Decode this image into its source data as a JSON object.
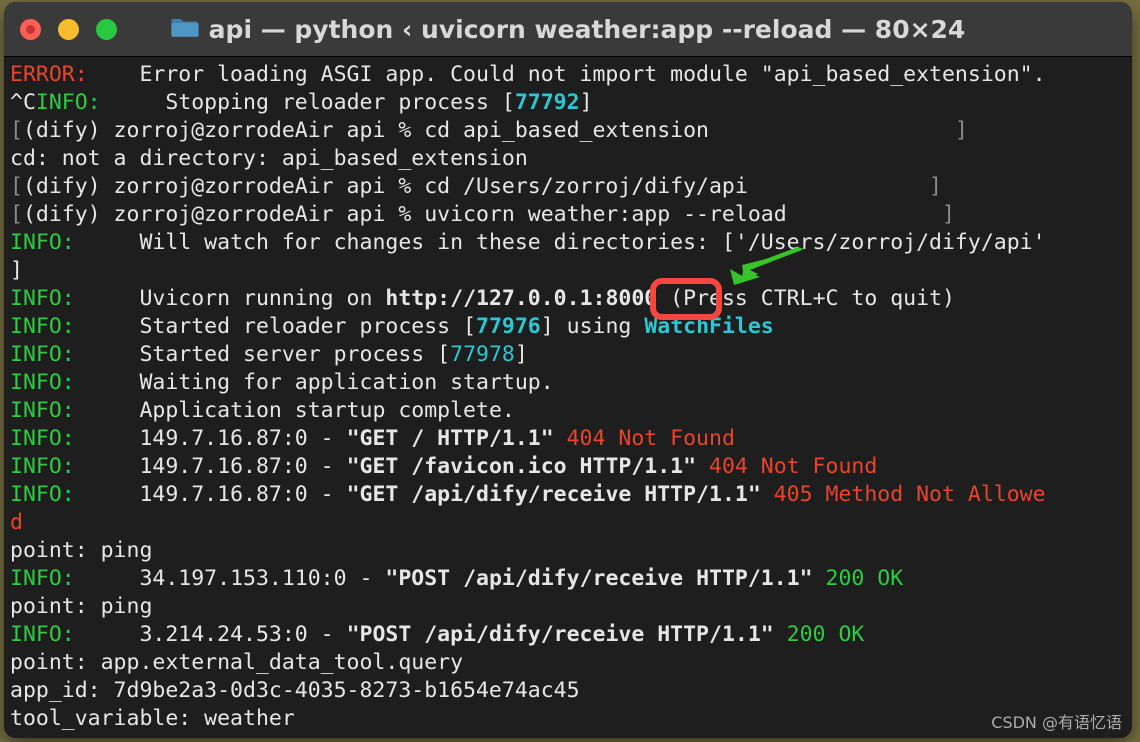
{
  "window": {
    "title": "api — python ‹ uvicorn weather:app --reload — 80×24",
    "folder_icon": "folder-icon",
    "controls": {
      "close": "close-button",
      "minimize": "minimize-button",
      "zoom": "zoom-button"
    }
  },
  "annotations": {
    "highlight_label": "8000",
    "highlight_color": "#f4473f",
    "arrow_color": "#38c32b"
  },
  "watermark": "CSDN @有语忆语",
  "colors": {
    "background": "#1e1e1e",
    "foreground": "#e6e6e6",
    "red": "#e8452c",
    "green": "#2ecc40",
    "cyan": "#2bc7d4",
    "gray": "#8a8a8a",
    "titlebar": "#3a3a3a"
  },
  "terminal": {
    "rows": 24,
    "cols": 80,
    "lines": [
      {
        "id": "line-1",
        "segs": [
          {
            "t": "ERROR:",
            "c": "c-red"
          },
          {
            "t": "    Error loading ASGI app. Could not import module \"api_based_extension\".",
            "c": "c-white"
          }
        ]
      },
      {
        "id": "line-2",
        "segs": [
          {
            "t": "^C",
            "c": "c-white"
          },
          {
            "t": "INFO:",
            "c": "c-green"
          },
          {
            "t": "     Stopping reloader process [",
            "c": "c-white"
          },
          {
            "t": "77792",
            "c": "c-cyan b"
          },
          {
            "t": "]",
            "c": "c-white"
          }
        ]
      },
      {
        "id": "line-3",
        "segs": [
          {
            "t": "[",
            "c": "c-gray"
          },
          {
            "t": "(dify) zorroj@zorrodeAir api % cd api_based_extension",
            "c": "c-white"
          },
          {
            "t": "                   ]",
            "c": "c-gray"
          }
        ]
      },
      {
        "id": "line-4",
        "segs": [
          {
            "t": "cd: not a directory: api_based_extension",
            "c": "c-white"
          }
        ]
      },
      {
        "id": "line-5",
        "segs": [
          {
            "t": "[",
            "c": "c-gray"
          },
          {
            "t": "(dify) zorroj@zorrodeAir api % cd /Users/zorroj/dify/api",
            "c": "c-white"
          },
          {
            "t": "              ]",
            "c": "c-gray"
          }
        ]
      },
      {
        "id": "line-6",
        "segs": [
          {
            "t": "[",
            "c": "c-gray"
          },
          {
            "t": "(dify) zorroj@zorrodeAir api % uvicorn weather:app --reload",
            "c": "c-white"
          },
          {
            "t": "            ]",
            "c": "c-gray"
          }
        ]
      },
      {
        "id": "line-7",
        "segs": [
          {
            "t": "INFO:",
            "c": "c-green"
          },
          {
            "t": "     Will watch for changes in these directories: ['/Users/zorroj/dify/api'",
            "c": "c-white"
          }
        ]
      },
      {
        "id": "line-8",
        "segs": [
          {
            "t": "]",
            "c": "c-white"
          }
        ]
      },
      {
        "id": "line-9",
        "segs": [
          {
            "t": "INFO:",
            "c": "c-green"
          },
          {
            "t": "     Uvicorn running on ",
            "c": "c-white"
          },
          {
            "t": "http://127.0.0.1:8000",
            "c": "c-white b"
          },
          {
            "t": " (Press CTRL+C to quit)",
            "c": "c-white"
          }
        ]
      },
      {
        "id": "line-10",
        "segs": [
          {
            "t": "INFO:",
            "c": "c-green"
          },
          {
            "t": "     Started reloader process [",
            "c": "c-white"
          },
          {
            "t": "77976",
            "c": "c-cyan b"
          },
          {
            "t": "] using ",
            "c": "c-white"
          },
          {
            "t": "WatchFiles",
            "c": "c-cyan b"
          }
        ]
      },
      {
        "id": "line-11",
        "segs": [
          {
            "t": "INFO:",
            "c": "c-green"
          },
          {
            "t": "     Started server process [",
            "c": "c-white"
          },
          {
            "t": "77978",
            "c": "c-cyan"
          },
          {
            "t": "]",
            "c": "c-white"
          }
        ]
      },
      {
        "id": "line-12",
        "segs": [
          {
            "t": "INFO:",
            "c": "c-green"
          },
          {
            "t": "     Waiting for application startup.",
            "c": "c-white"
          }
        ]
      },
      {
        "id": "line-13",
        "segs": [
          {
            "t": "INFO:",
            "c": "c-green"
          },
          {
            "t": "     Application startup complete.",
            "c": "c-white"
          }
        ]
      },
      {
        "id": "line-14",
        "segs": [
          {
            "t": "INFO:",
            "c": "c-green"
          },
          {
            "t": "     149.7.16.87:0 - ",
            "c": "c-white"
          },
          {
            "t": "\"GET / HTTP/1.1\"",
            "c": "c-white b"
          },
          {
            "t": " 404 Not Found",
            "c": "c-red"
          }
        ]
      },
      {
        "id": "line-15",
        "segs": [
          {
            "t": "INFO:",
            "c": "c-green"
          },
          {
            "t": "     149.7.16.87:0 - ",
            "c": "c-white"
          },
          {
            "t": "\"GET /favicon.ico HTTP/1.1\"",
            "c": "c-white b"
          },
          {
            "t": " 404 Not Found",
            "c": "c-red"
          }
        ]
      },
      {
        "id": "line-16",
        "segs": [
          {
            "t": "INFO:",
            "c": "c-green"
          },
          {
            "t": "     149.7.16.87:0 - ",
            "c": "c-white"
          },
          {
            "t": "\"GET /api/dify/receive HTTP/1.1\"",
            "c": "c-white b"
          },
          {
            "t": " 405 Method Not Allowe",
            "c": "c-red"
          }
        ]
      },
      {
        "id": "line-17",
        "segs": [
          {
            "t": "d",
            "c": "c-red"
          }
        ]
      },
      {
        "id": "line-18",
        "segs": [
          {
            "t": "point: ping",
            "c": "c-white"
          }
        ]
      },
      {
        "id": "line-19",
        "segs": [
          {
            "t": "INFO:",
            "c": "c-green"
          },
          {
            "t": "     34.197.153.110:0 - ",
            "c": "c-white"
          },
          {
            "t": "\"POST /api/dify/receive HTTP/1.1\"",
            "c": "c-white b"
          },
          {
            "t": " 200 OK",
            "c": "c-green"
          }
        ]
      },
      {
        "id": "line-20",
        "segs": [
          {
            "t": "point: ping",
            "c": "c-white"
          }
        ]
      },
      {
        "id": "line-21",
        "segs": [
          {
            "t": "INFO:",
            "c": "c-green"
          },
          {
            "t": "     3.214.24.53:0 - ",
            "c": "c-white"
          },
          {
            "t": "\"POST /api/dify/receive HTTP/1.1\"",
            "c": "c-white b"
          },
          {
            "t": " 200 OK",
            "c": "c-green"
          }
        ]
      },
      {
        "id": "line-22",
        "segs": [
          {
            "t": "point: app.external_data_tool.query",
            "c": "c-white"
          }
        ]
      },
      {
        "id": "line-23",
        "segs": [
          {
            "t": "app_id: 7d9be2a3-0d3c-4035-8273-b1654e74ac45",
            "c": "c-white"
          }
        ]
      },
      {
        "id": "line-24",
        "segs": [
          {
            "t": "tool_variable: weather",
            "c": "c-white"
          }
        ]
      }
    ]
  }
}
